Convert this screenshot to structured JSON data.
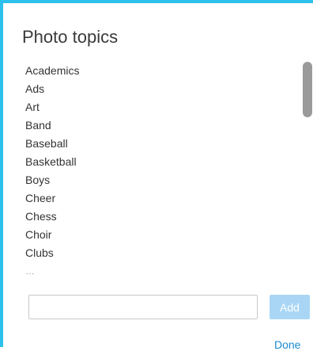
{
  "dialog": {
    "title": "Photo topics",
    "topics": [
      "Academics",
      "Ads",
      "Art",
      "Band",
      "Baseball",
      "Basketball",
      "Boys",
      "Cheer",
      "Chess",
      "Choir",
      "Clubs",
      "..."
    ],
    "input": {
      "value": "",
      "placeholder": ""
    },
    "add_label": "Add",
    "done_label": "Done"
  },
  "colors": {
    "accent_border": "#2ec0ec",
    "add_button_bg": "#a9d6f5",
    "link": "#1b8ad0",
    "scrollbar_thumb": "#9a9a9a"
  }
}
